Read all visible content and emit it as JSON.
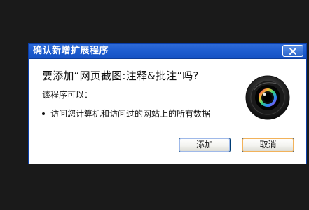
{
  "dialog": {
    "title": "确认新增扩展程序",
    "question": "要添加“网页截图:注释&批注”吗?",
    "can_do_label": "该程序可以：",
    "permissions": [
      "访问您计算机和访问过的网站上的所有数据"
    ],
    "buttons": {
      "confirm_label": "添加",
      "cancel_label": "取消"
    },
    "icons": {
      "close": "close-icon",
      "extension": "camera-lens-icon"
    }
  }
}
